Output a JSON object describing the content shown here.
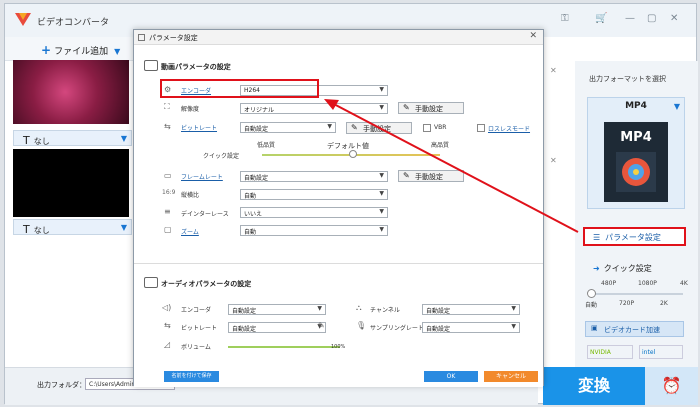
{
  "app": {
    "title": "ビデオコンバータ"
  },
  "toolbar": {
    "add_file": "ファイル追加"
  },
  "files": [
    {
      "subtitle": "なし"
    },
    {
      "subtitle": "なし"
    }
  ],
  "right_panel": {
    "output_format_label": "出力フォーマットを選択",
    "format": "MP4",
    "format_icon_text": "MP4",
    "param_button": "パラメータ設定",
    "quick_title": "クイック設定",
    "quick_top": [
      "480P",
      "1080P",
      "4K"
    ],
    "quick_bottom": [
      "自動",
      "720P",
      "2K"
    ],
    "quick_level": 0,
    "gpu_button": "ビデオカード加速",
    "gpu_vendors": [
      "NVIDIA",
      "intel"
    ]
  },
  "bottom": {
    "output_folder_label": "出力フォルダ：",
    "output_path": "C:\\Users\\Administrator\\",
    "convert": "変換"
  },
  "dialog": {
    "title": "パラメータ設定",
    "video_section": "動画パラメータの設定",
    "video": {
      "encoder_label": "エンコーダ",
      "encoder_value": "H264",
      "resolution_label": "解像度",
      "resolution_value": "オリジナル",
      "bitrate_label": "ビットレート",
      "bitrate_value": "自動設定",
      "vbr_label": "VBR",
      "lossless_label": "ロスレスモード",
      "quick_label": "クイック設定",
      "low_quality": "低品質",
      "default_value": "デフォルト値",
      "high_quality": "高品質",
      "framerate_label": "フレームレート",
      "framerate_value": "自動設定",
      "aspect_label": "縦横比",
      "aspect_value": "自動",
      "deinterlace_label": "デインターレース",
      "deinterlace_value": "いいえ",
      "zoom_label": "ズーム",
      "zoom_value": "自動",
      "manual": "手動設定"
    },
    "audio_section": "オーディオパラメータの設定",
    "audio": {
      "encoder_label": "エンコーダ",
      "encoder_value": "自動設定",
      "channel_label": "チャンネル",
      "channel_value": "自動設定",
      "bitrate_label": "ビットレート",
      "bitrate_value": "自動設定",
      "samplerate_label": "サンプリングレート",
      "samplerate_value": "自動設定",
      "volume_label": "ボリューム",
      "volume_value": "100%"
    },
    "footer": {
      "save_named": "名前を付けて保存",
      "ok": "OK",
      "cancel": "キャンセル"
    }
  },
  "colors": {
    "accent": "#1a93e8",
    "highlight": "#e0111a",
    "cancel": "#f28a2c"
  }
}
